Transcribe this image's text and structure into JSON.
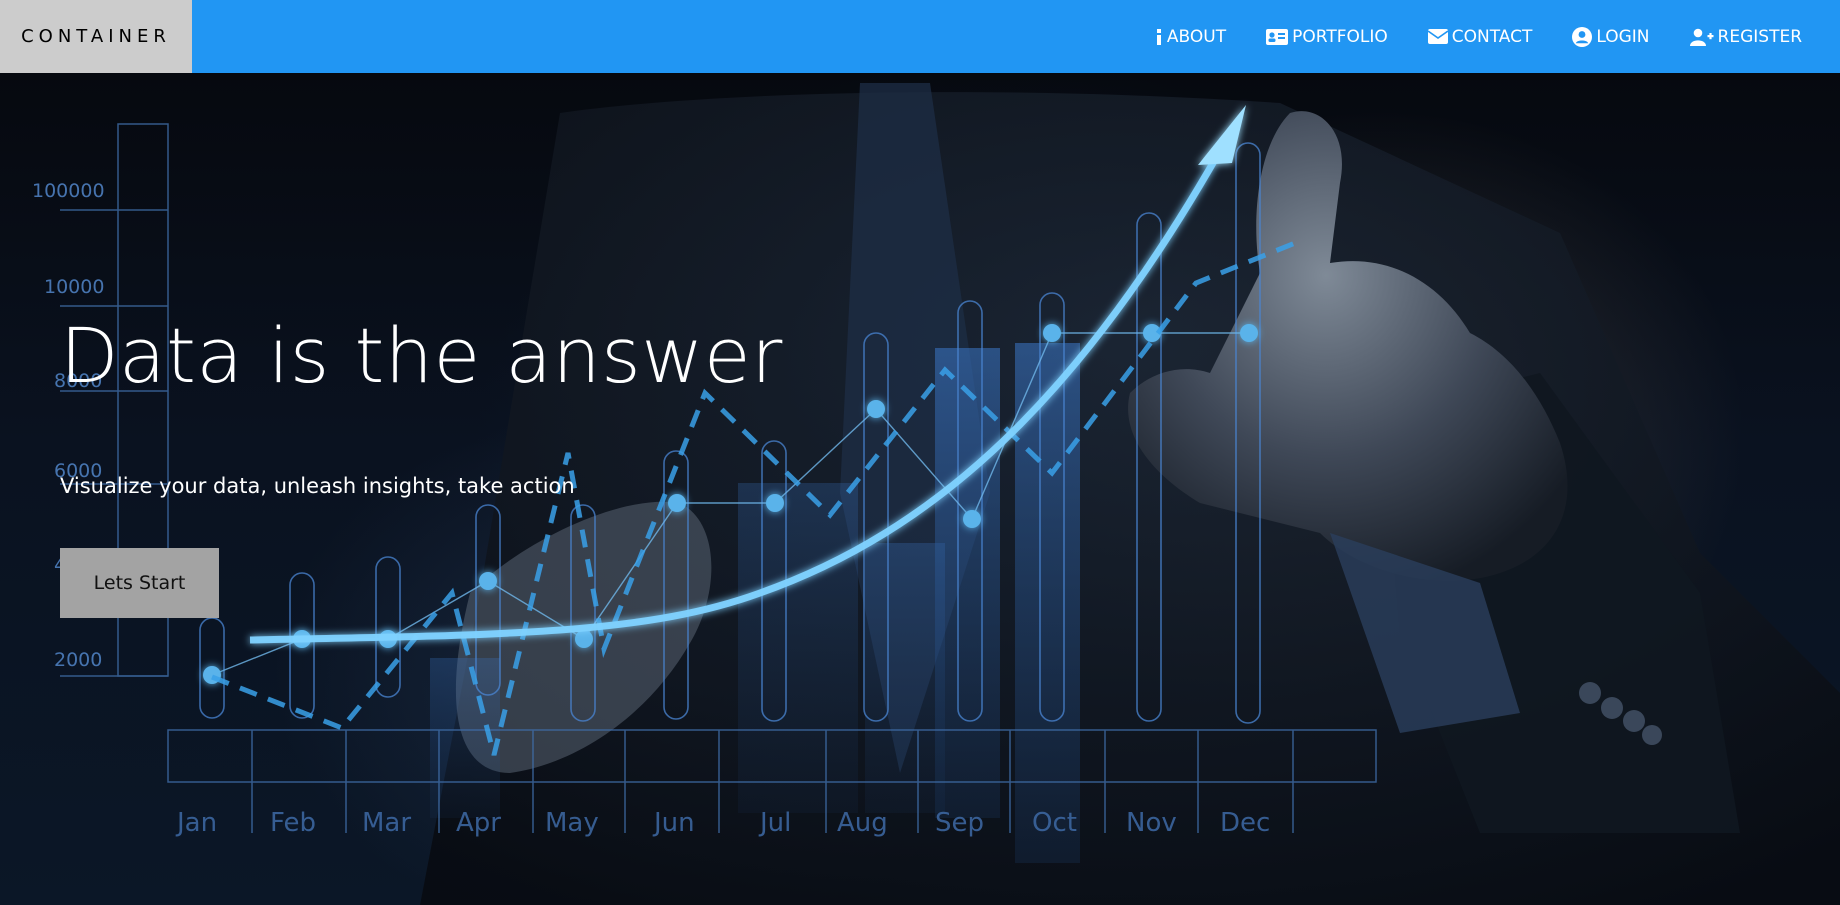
{
  "brand": {
    "name": "CONTAINER"
  },
  "nav": {
    "items": [
      {
        "label": "ABOUT",
        "icon": "info-icon"
      },
      {
        "label": "PORTFOLIO",
        "icon": "id-card-icon"
      },
      {
        "label": "CONTACT",
        "icon": "envelope-icon"
      },
      {
        "label": "LOGIN",
        "icon": "user-circle-icon"
      },
      {
        "label": "REGISTER",
        "icon": "user-plus-icon"
      }
    ]
  },
  "hero": {
    "title": "Data is the answer",
    "subtitle": "Visualize your data, unleash insights, take action",
    "cta_label": "Lets Start",
    "background_chart": {
      "y_ticks": [
        "100000",
        "10000",
        "8000",
        "6000",
        "4000",
        "2000"
      ],
      "months": [
        "Jan",
        "Feb",
        "Mar",
        "Apr",
        "May",
        "Jun",
        "Jul",
        "Aug",
        "Sep",
        "Oct",
        "Nov",
        "Dec"
      ]
    }
  },
  "colors": {
    "nav_bg": "#2196f3",
    "brand_bg": "#cccccc",
    "cta_bg": "#a3a3a3",
    "chart_glow": "#4fb8f0"
  }
}
